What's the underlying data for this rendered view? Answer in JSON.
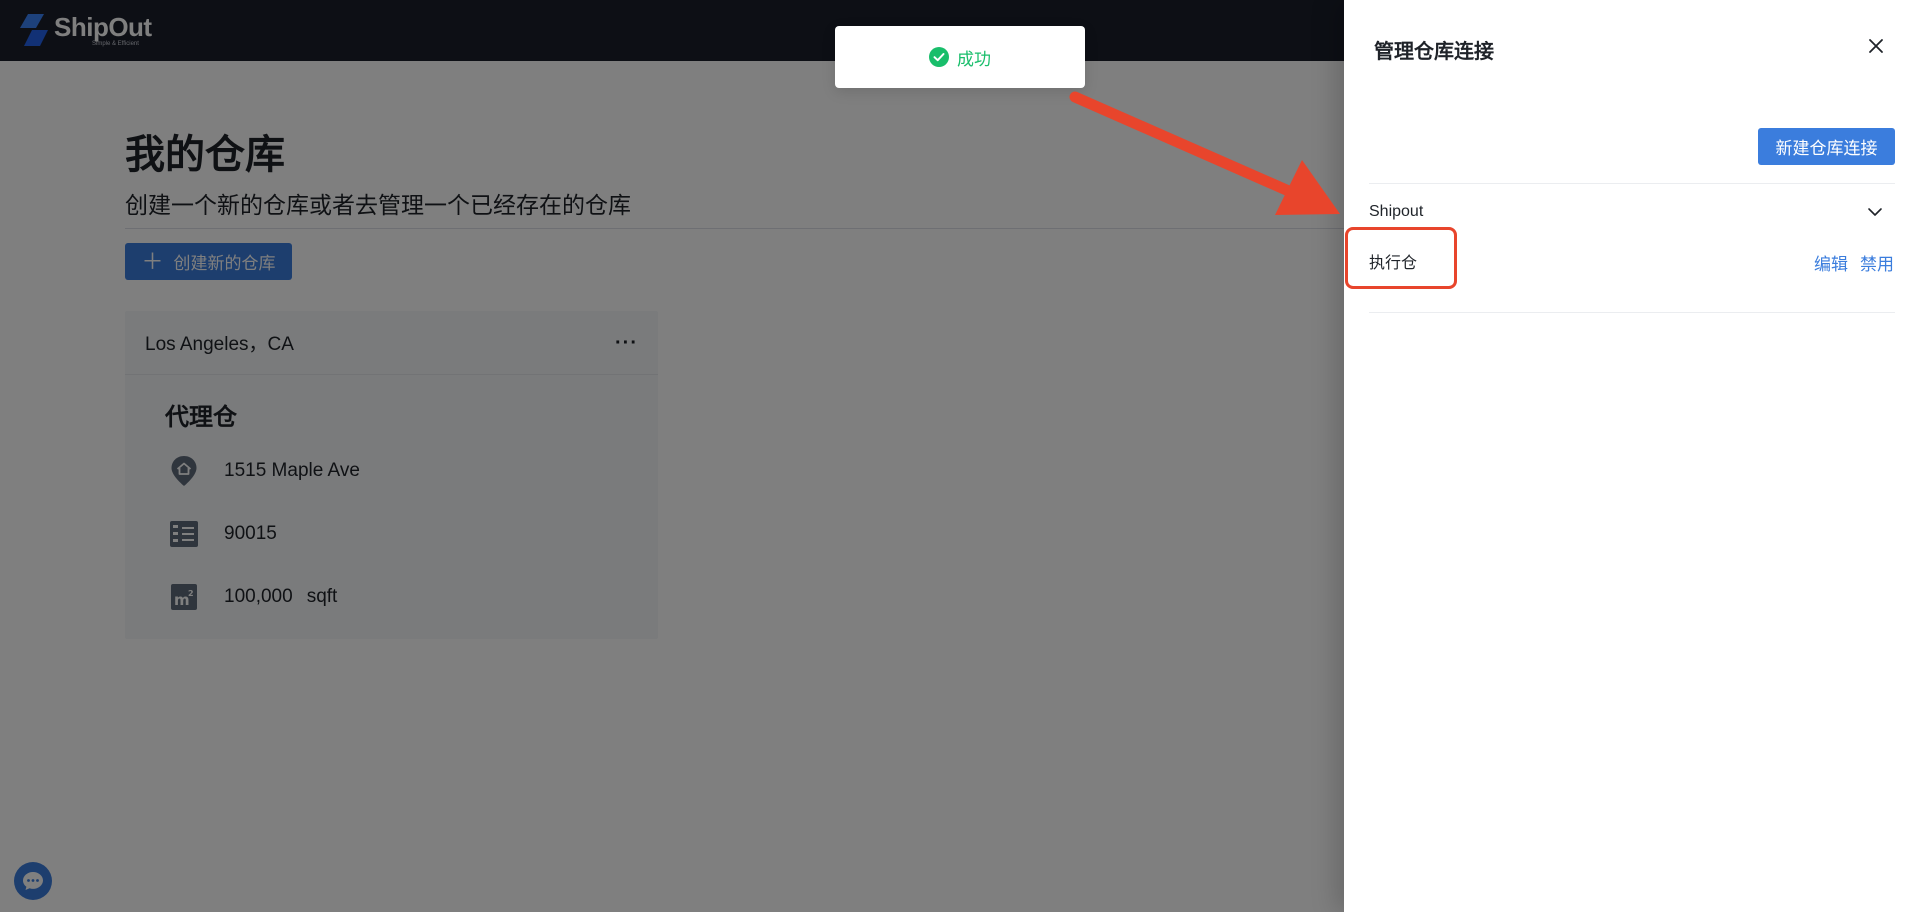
{
  "app": {
    "logo": {
      "word": "ShipOut",
      "tagline": "Simple & Efficient"
    },
    "page": {
      "title": "我的仓库",
      "subtitle": "创建一个新的仓库或者去管理一个已经存在的仓库",
      "create_button": "创建新的仓库"
    },
    "warehouse_card": {
      "city": "Los Angeles，CA",
      "more": "···",
      "type": "代理仓",
      "address": "1515 Maple Ave",
      "zip": "90015",
      "area_value": "100,000",
      "area_unit": "sqft"
    }
  },
  "toast": {
    "text": "成功",
    "color": "#19be6b"
  },
  "drawer": {
    "title": "管理仓库连接",
    "new_button": "新建仓库连接",
    "connections": [
      {
        "name": "Shipout",
        "item": "执行仓",
        "edit": "编辑",
        "disable": "禁用"
      }
    ]
  },
  "colors": {
    "accent": "#3b7ddd",
    "topbar": "#1b1f2a",
    "annotation": "#e8452c"
  },
  "icons": [
    "check-circle-icon",
    "close-icon",
    "chevron-down-icon",
    "location-pin-icon",
    "zip-code-icon",
    "square-meter-icon",
    "chat-icon",
    "plus-icon"
  ]
}
